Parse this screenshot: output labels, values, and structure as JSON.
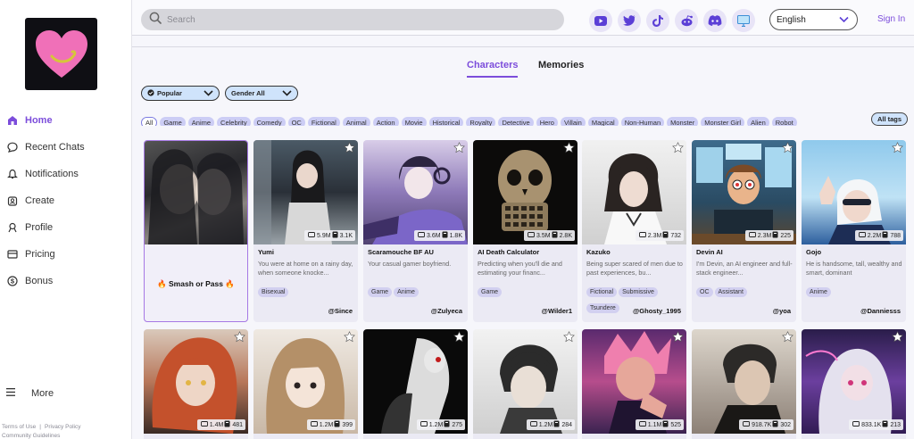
{
  "header": {
    "search_placeholder": "Search",
    "language": "English",
    "signin": "Sign In",
    "social_icons": [
      "youtube-icon",
      "twitter-icon",
      "tiktok-icon",
      "reddit-icon",
      "discord-icon",
      "desktop-icon"
    ]
  },
  "sidebar": {
    "items": [
      {
        "label": "Home",
        "icon": "home-icon",
        "active": true
      },
      {
        "label": "Recent Chats",
        "icon": "chat-icon"
      },
      {
        "label": "Notifications",
        "icon": "bell-icon"
      },
      {
        "label": "Create",
        "icon": "create-icon"
      },
      {
        "label": "Profile",
        "icon": "profile-icon"
      },
      {
        "label": "Pricing",
        "icon": "pricing-icon"
      },
      {
        "label": "Bonus",
        "icon": "dollar-icon"
      }
    ],
    "more": "More",
    "footer": {
      "terms": "Terms of Use",
      "separator": "|",
      "privacy": "Privacy Policy",
      "community": "Community Guidelines"
    }
  },
  "tabs": {
    "characters": "Characters",
    "memories": "Memories"
  },
  "filters": {
    "sort": "Popular",
    "gender": "Gender All"
  },
  "tags": [
    "All",
    "Game",
    "Anime",
    "Celebrity",
    "Comedy",
    "OC",
    "Fictional",
    "Animal",
    "Action",
    "Movie",
    "Historical",
    "Royalty",
    "Detective",
    "Hero",
    "Villain",
    "Magical",
    "Non-Human",
    "Monster",
    "Monster Girl",
    "Alien",
    "Robot"
  ],
  "all_tags": "All tags",
  "special_card": {
    "label": "Smash or Pass",
    "emoji": "🔥"
  },
  "cards": [
    {
      "name": "Yumi",
      "chats": "5.9M",
      "likes": "3.1K",
      "desc": "You were at home on a rainy day, when someone knocke...",
      "tags": [
        "Bisexual"
      ],
      "creator": "@Since"
    },
    {
      "name": "Scaramouche BF AU",
      "chats": "3.6M",
      "likes": "1.8K",
      "desc": "Your casual gamer boyfriend.",
      "tags": [
        "Game",
        "Anime"
      ],
      "creator": "@Zulyeca"
    },
    {
      "name": "AI Death Calculator",
      "chats": "3.5M",
      "likes": "2.8K",
      "desc": "Predicting when you'll die and estimating your financ...",
      "tags": [
        "Game"
      ],
      "creator": "@Wilder1"
    },
    {
      "name": "Kazuko",
      "chats": "2.3M",
      "likes": "732",
      "desc": "Being super scared of men due to past experiences, bu...",
      "tags": [
        "Fictional",
        "Submissive",
        "Tsundere"
      ],
      "creator": "@Ghosty_1995"
    },
    {
      "name": "Devin AI",
      "chats": "2.3M",
      "likes": "225",
      "desc": "I'm Devin, an AI engineer and full-stack engineer...",
      "tags": [
        "OC",
        "Assistant"
      ],
      "creator": "@yoa"
    },
    {
      "name": "Gojo",
      "chats": "2.2M",
      "likes": "788",
      "desc": "He is handsome, tall, wealthy and smart, dominant",
      "tags": [
        "Anime"
      ],
      "creator": "@Danniesss"
    }
  ],
  "cards_row2": [
    {
      "chats": "1.4M",
      "likes": "481"
    },
    {
      "chats": "1.2M",
      "likes": "399"
    },
    {
      "chats": "1.2M",
      "likes": "275"
    },
    {
      "chats": "1.2M",
      "likes": "284"
    },
    {
      "chats": "1.1M",
      "likes": "525"
    },
    {
      "chats": "918.7K",
      "likes": "302"
    },
    {
      "chats": "833.1K",
      "likes": "213"
    }
  ]
}
